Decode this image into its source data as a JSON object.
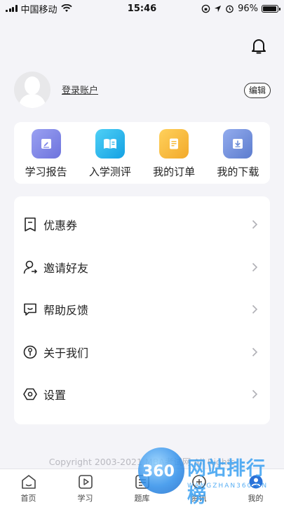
{
  "status_bar": {
    "carrier": "中国移动",
    "time": "15:46",
    "battery": "96%"
  },
  "header": {
    "bell_icon": "bell-icon"
  },
  "profile": {
    "login_text": "登录账户",
    "edit_label": "编辑"
  },
  "quick_actions": [
    {
      "label": "学习报告",
      "icon": "report-icon",
      "color": "#7b83e8"
    },
    {
      "label": "入学测评",
      "icon": "book-icon",
      "color": "#23b0ea"
    },
    {
      "label": "我的订单",
      "icon": "order-icon",
      "color": "#f5b936"
    },
    {
      "label": "我的下载",
      "icon": "download-icon",
      "color": "#6f8fd6"
    }
  ],
  "menu": [
    {
      "label": "优惠券",
      "icon": "coupon-icon"
    },
    {
      "label": "邀请好友",
      "icon": "invite-user-icon"
    },
    {
      "label": "帮助反馈",
      "icon": "feedback-icon"
    },
    {
      "label": "关于我们",
      "icon": "about-icon"
    },
    {
      "label": "设置",
      "icon": "settings-icon"
    }
  ],
  "footer": {
    "copyright": "Copyright 2003-2021 MBA考试网 All Rights"
  },
  "tabs": [
    {
      "label": "首页",
      "icon": "home-icon"
    },
    {
      "label": "学习",
      "icon": "play-icon"
    },
    {
      "label": "题库",
      "icon": "question-bank-icon"
    },
    {
      "label": "资讯",
      "icon": "news-icon"
    },
    {
      "label": "我的",
      "icon": "profile-icon"
    }
  ],
  "watermark": {
    "number": "360",
    "text": "网站排行榜",
    "sub": "WANGZHAN360.CN"
  }
}
